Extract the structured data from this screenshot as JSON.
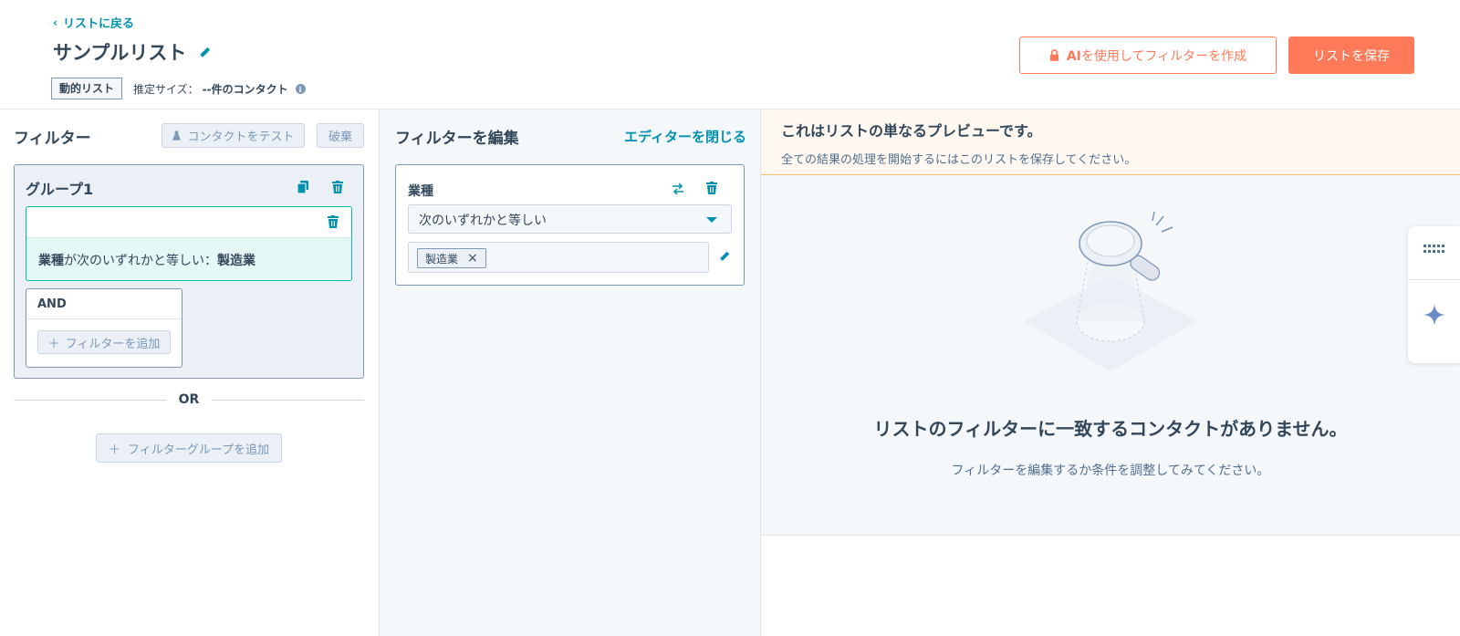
{
  "header": {
    "back_label": "リストに戻る",
    "title": "サンプルリスト",
    "list_type": "動的リスト",
    "size_prefix": "推定サイズ：",
    "size_value": "--件のコンタクト",
    "ai_button_prefix": "AI",
    "ai_button_suffix": "を使用してフィルターを作成",
    "save_label": "リストを保存"
  },
  "left": {
    "title": "フィルター",
    "test_contact_label": "コンタクトをテスト",
    "discard_label": "破棄",
    "group": {
      "title": "グループ1",
      "filter": {
        "property": "業種",
        "operator_text": "が次のいずれかと等しい：",
        "value": "製造業"
      },
      "and_label": "AND",
      "add_filter_label": "フィルターを追加"
    },
    "or_label": "OR",
    "add_group_label": "フィルターグループを追加"
  },
  "middle": {
    "title": "フィルターを編集",
    "close_label": "エディターを閉じる",
    "field_name": "業種",
    "operator": "次のいずれかと等しい",
    "tags": [
      "製造業"
    ]
  },
  "right": {
    "banner_title": "これはリストの単なるプレビューです。",
    "banner_text": "全ての結果の処理を開始するにはこのリストを保存してください。",
    "empty_title": "リストのフィルターに一致するコンタクトがありません。",
    "empty_sub": "フィルターを編集するか条件を調整してみてください。"
  },
  "colors": {
    "accent": "#ff7a59",
    "link": "#0091ae",
    "text": "#33475b",
    "teal": "#00bda5"
  }
}
